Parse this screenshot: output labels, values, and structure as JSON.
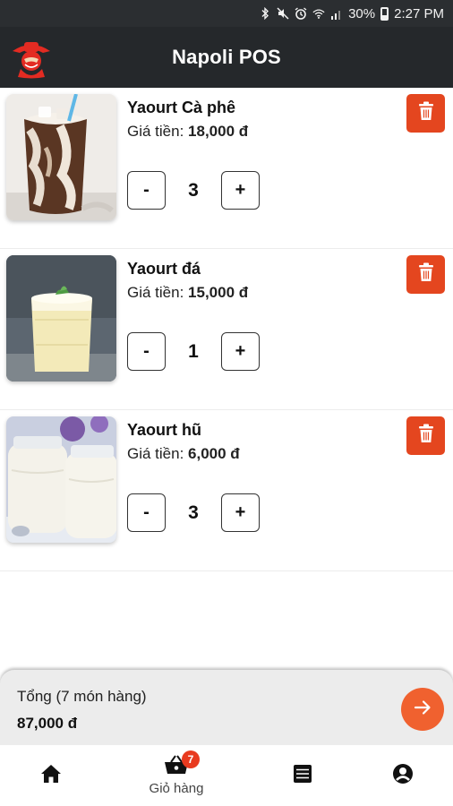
{
  "status_bar": {
    "battery": "30%",
    "time": "2:27 PM"
  },
  "app_bar": {
    "title": "Napoli POS"
  },
  "cart": {
    "items": [
      {
        "name": "Yaourt Cà phê",
        "price_label": "Giá tiền:",
        "price": "18,000 đ",
        "quantity": "3",
        "minus": "-",
        "plus": "+"
      },
      {
        "name": "Yaourt đá",
        "price_label": "Giá tiền:",
        "price": "15,000 đ",
        "quantity": "1",
        "minus": "-",
        "plus": "+"
      },
      {
        "name": "Yaourt hũ",
        "price_label": "Giá tiền:",
        "price": "6,000 đ",
        "quantity": "3",
        "minus": "-",
        "plus": "+"
      }
    ]
  },
  "summary": {
    "label": "Tổng (7 món hàng)",
    "total": "87,000 đ"
  },
  "bottom_nav": {
    "cart_label": "Giỏ hàng",
    "cart_badge": "7"
  },
  "colors": {
    "accent": "#e4461f",
    "checkout": "#f0612f",
    "app_bar": "#25282b"
  },
  "icons": [
    "bluetooth-icon",
    "mute-icon",
    "alarm-icon",
    "wifi-icon",
    "signal-icon",
    "battery-icon",
    "logo-icon",
    "trash-icon",
    "arrow-right-icon",
    "home-icon",
    "basket-icon",
    "list-icon",
    "account-icon"
  ]
}
